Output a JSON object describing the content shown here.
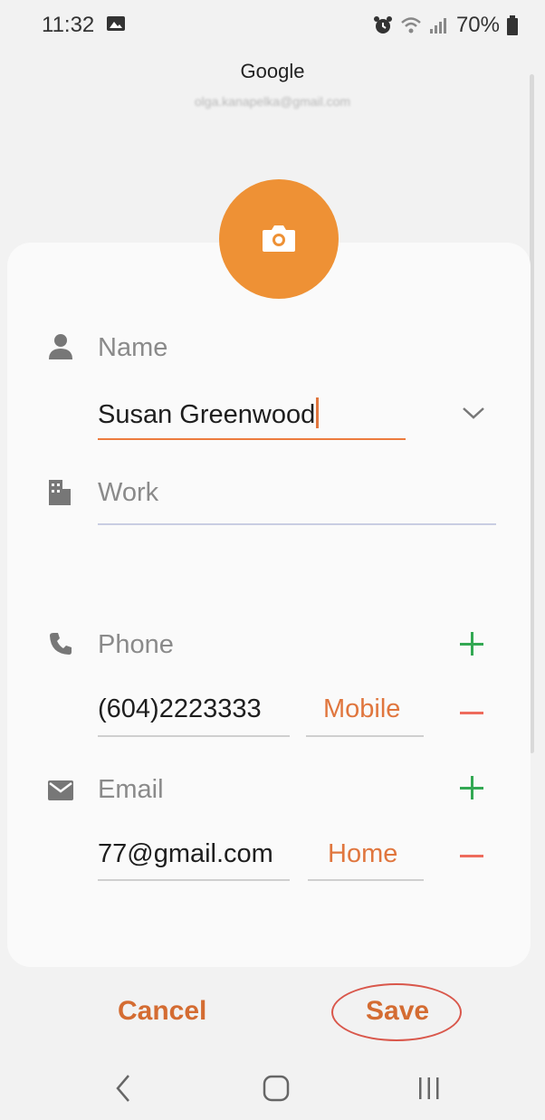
{
  "status": {
    "time": "11:32",
    "battery": "70%"
  },
  "account": {
    "provider": "Google",
    "email": "olga.kanapelka@gmail.com"
  },
  "name_section": {
    "label": "Name",
    "value": "Susan Greenwood"
  },
  "work_section": {
    "placeholder": "Work"
  },
  "phone_section": {
    "label": "Phone",
    "value": "(604)2223333",
    "type": "Mobile"
  },
  "email_section": {
    "label": "Email",
    "value": "77@gmail.com",
    "type": "Home"
  },
  "actions": {
    "cancel": "Cancel",
    "save": "Save"
  },
  "colors": {
    "avatar": "#ee9135",
    "accent": "#e0763e",
    "add": "#33a853",
    "remove": "#ee6b5c",
    "highlight_ring": "#d9574b"
  },
  "icons": [
    "picture-icon",
    "alarm-icon",
    "wifi-icon",
    "signal-icon",
    "battery-icon",
    "camera-icon",
    "person-icon",
    "building-icon",
    "phone-icon",
    "mail-icon",
    "chevron-down-icon",
    "plus-icon",
    "minus-icon",
    "back-icon",
    "home-icon",
    "recents-icon"
  ]
}
